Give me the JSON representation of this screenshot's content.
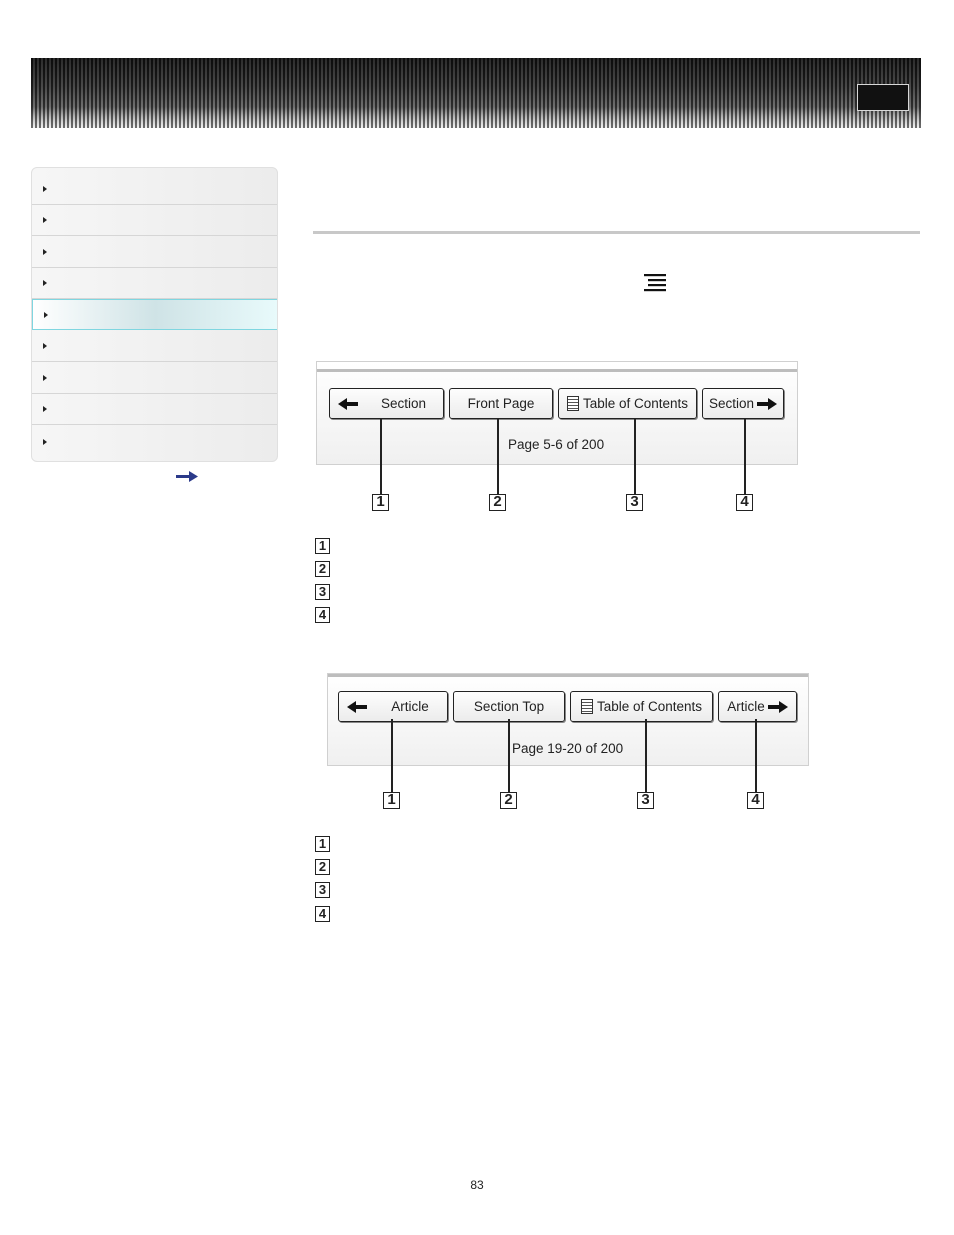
{
  "banner": {
    "icon": "black-box-button"
  },
  "sidebar": {
    "items": [
      {
        "label": "",
        "active": false
      },
      {
        "label": "",
        "active": false
      },
      {
        "label": "",
        "active": false
      },
      {
        "label": "",
        "active": false
      },
      {
        "label": "",
        "active": true
      },
      {
        "label": "",
        "active": false
      },
      {
        "label": "",
        "active": false
      },
      {
        "label": "",
        "active": false
      },
      {
        "label": "",
        "active": false
      }
    ],
    "more_icon": "right-arrow-icon"
  },
  "content": {
    "menu_icon": "menu-lines-icon"
  },
  "figure1": {
    "buttons": [
      "Section",
      "Front Page",
      "Table of Contents",
      "Section"
    ],
    "page_text": "Page 5-6 of 200",
    "callouts": [
      "1",
      "2",
      "3",
      "4"
    ],
    "legend": [
      "1",
      "2",
      "3",
      "4"
    ]
  },
  "figure2": {
    "buttons": [
      "Article",
      "Section Top",
      "Table of Contents",
      "Article"
    ],
    "page_text": "Page 19-20 of 200",
    "callouts": [
      "1",
      "2",
      "3",
      "4"
    ],
    "legend": [
      "1",
      "2",
      "3",
      "4"
    ]
  },
  "footer": {
    "page_number": "83"
  },
  "colors": {
    "accent_active": "#7fd6e0",
    "rule": "#c8c8c8"
  }
}
